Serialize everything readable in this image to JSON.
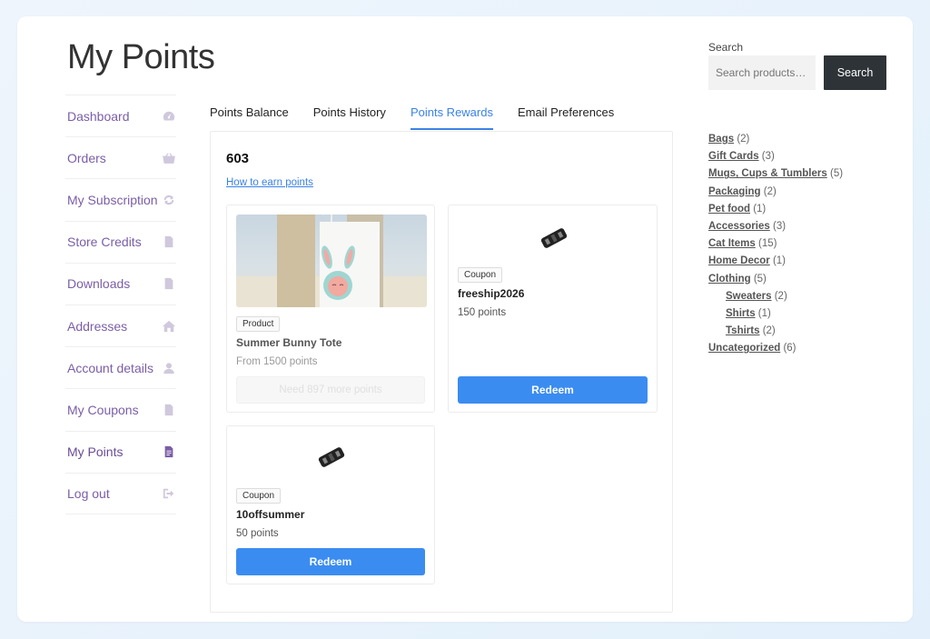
{
  "page": {
    "title": "My Points"
  },
  "nav": [
    {
      "label": "Dashboard",
      "icon": "dashboard-icon"
    },
    {
      "label": "Orders",
      "icon": "basket-icon"
    },
    {
      "label": "My Subscription",
      "icon": "refresh-icon"
    },
    {
      "label": "Store Credits",
      "icon": "document-icon"
    },
    {
      "label": "Downloads",
      "icon": "download-file-icon"
    },
    {
      "label": "Addresses",
      "icon": "home-icon"
    },
    {
      "label": "Account details",
      "icon": "user-icon"
    },
    {
      "label": "My Coupons",
      "icon": "document-icon"
    },
    {
      "label": "My Points",
      "icon": "document-icon"
    },
    {
      "label": "Log out",
      "icon": "logout-icon"
    }
  ],
  "tabs": [
    {
      "label": "Points Balance"
    },
    {
      "label": "Points History"
    },
    {
      "label": "Points Rewards"
    },
    {
      "label": "Email Preferences"
    }
  ],
  "content": {
    "points_total": "603",
    "earn_link": "How to earn points",
    "rewards": [
      {
        "badge": "Product",
        "name": "Summer Bunny Tote",
        "points": "From 1500 points",
        "action": "Need 897 more points"
      },
      {
        "badge": "Coupon",
        "name": "freeship2026",
        "points": "150 points",
        "action": "Redeem"
      },
      {
        "badge": "Coupon",
        "name": "10offsummer",
        "points": "50 points",
        "action": "Redeem"
      }
    ]
  },
  "search": {
    "label": "Search",
    "placeholder": "Search products…",
    "button": "Search"
  },
  "categories": [
    {
      "name": "Bags",
      "count": "(2)"
    },
    {
      "name": "Gift Cards",
      "count": "(3)"
    },
    {
      "name": "Mugs, Cups & Tumblers",
      "count": "(5)"
    },
    {
      "name": "Packaging",
      "count": "(2)"
    },
    {
      "name": "Pet food",
      "count": "(1)"
    },
    {
      "name": "Accessories",
      "count": "(3)"
    },
    {
      "name": "Cat Items",
      "count": "(15)"
    },
    {
      "name": "Home Decor",
      "count": "(1)"
    },
    {
      "name": "Clothing",
      "count": "(5)"
    },
    {
      "name": "Sweaters",
      "count": "(2)"
    },
    {
      "name": "Shirts",
      "count": "(1)"
    },
    {
      "name": "Tshirts",
      "count": "(2)"
    },
    {
      "name": "Uncategorized",
      "count": "(6)"
    }
  ],
  "colors": {
    "accent": "#3b8cf0",
    "nav_link": "#7b5ea7",
    "search_button": "#2e3338"
  }
}
